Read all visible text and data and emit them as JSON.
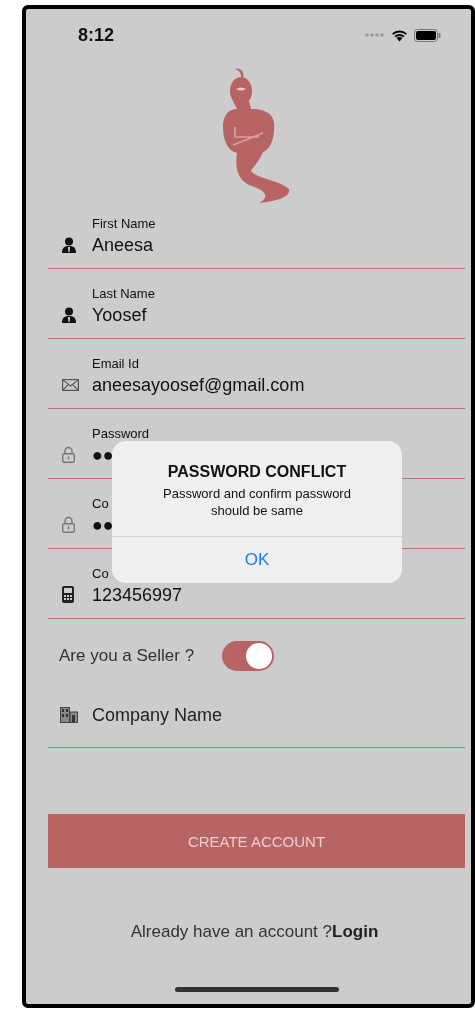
{
  "status_bar": {
    "time": "8:12"
  },
  "fields": [
    {
      "kind": "person",
      "label": "First Name",
      "value": "Aneesa"
    },
    {
      "kind": "person",
      "label": "Last Name",
      "value": "Yoosef"
    },
    {
      "kind": "mail",
      "label": "Email Id",
      "value": "aneesayoosef@gmail.com"
    },
    {
      "kind": "lock",
      "label": "Password",
      "value": "●●"
    },
    {
      "kind": "lock",
      "label": "Co",
      "value": "●●"
    },
    {
      "kind": "phone",
      "label": "Co",
      "value": "123456997"
    }
  ],
  "seller": {
    "label": "Are you a Seller ?",
    "on": true
  },
  "company": {
    "kind": "building",
    "placeholder": "Company Name"
  },
  "button": "CREATE ACCOUNT",
  "footer": {
    "text": "Already have an account ?",
    "link": "Login"
  },
  "alert": {
    "title": "PASSWORD CONFLICT",
    "message": "Password and confirm password should be same",
    "button": "OK"
  }
}
